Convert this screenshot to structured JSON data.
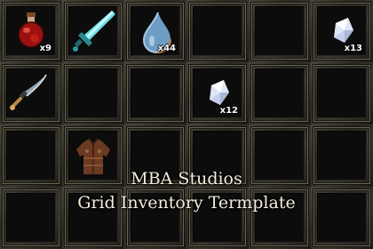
{
  "inventory": {
    "columns": 6,
    "rows": 4,
    "slots": [
      {
        "item": "health-potion-icon",
        "qty": "x9"
      },
      {
        "item": "crystal-sword-icon",
        "qty": ""
      },
      {
        "item": "water-drop-icon",
        "qty": "x44"
      },
      {
        "item": "",
        "qty": ""
      },
      {
        "item": "",
        "qty": ""
      },
      {
        "item": "crystal-shard-icon",
        "qty": "x13"
      },
      {
        "item": "curved-dagger-icon",
        "qty": ""
      },
      {
        "item": "",
        "qty": ""
      },
      {
        "item": "",
        "qty": ""
      },
      {
        "item": "crystal-shard-icon",
        "qty": "x12"
      },
      {
        "item": "",
        "qty": ""
      },
      {
        "item": "",
        "qty": ""
      },
      {
        "item": "",
        "qty": ""
      },
      {
        "item": "leather-armor-icon",
        "qty": ""
      },
      {
        "item": "",
        "qty": ""
      },
      {
        "item": "",
        "qty": ""
      },
      {
        "item": "",
        "qty": ""
      },
      {
        "item": "",
        "qty": ""
      },
      {
        "item": "",
        "qty": ""
      },
      {
        "item": "",
        "qty": ""
      },
      {
        "item": "",
        "qty": ""
      },
      {
        "item": "",
        "qty": ""
      },
      {
        "item": "",
        "qty": ""
      },
      {
        "item": "",
        "qty": ""
      }
    ]
  },
  "caption": {
    "line1": "MBA Studios",
    "line2": "Grid Inventory Termplate"
  },
  "colors": {
    "slot_frame": "#6b6654",
    "slot_bg": "#0c0c0c",
    "caption_text": "#f2ecdc"
  }
}
